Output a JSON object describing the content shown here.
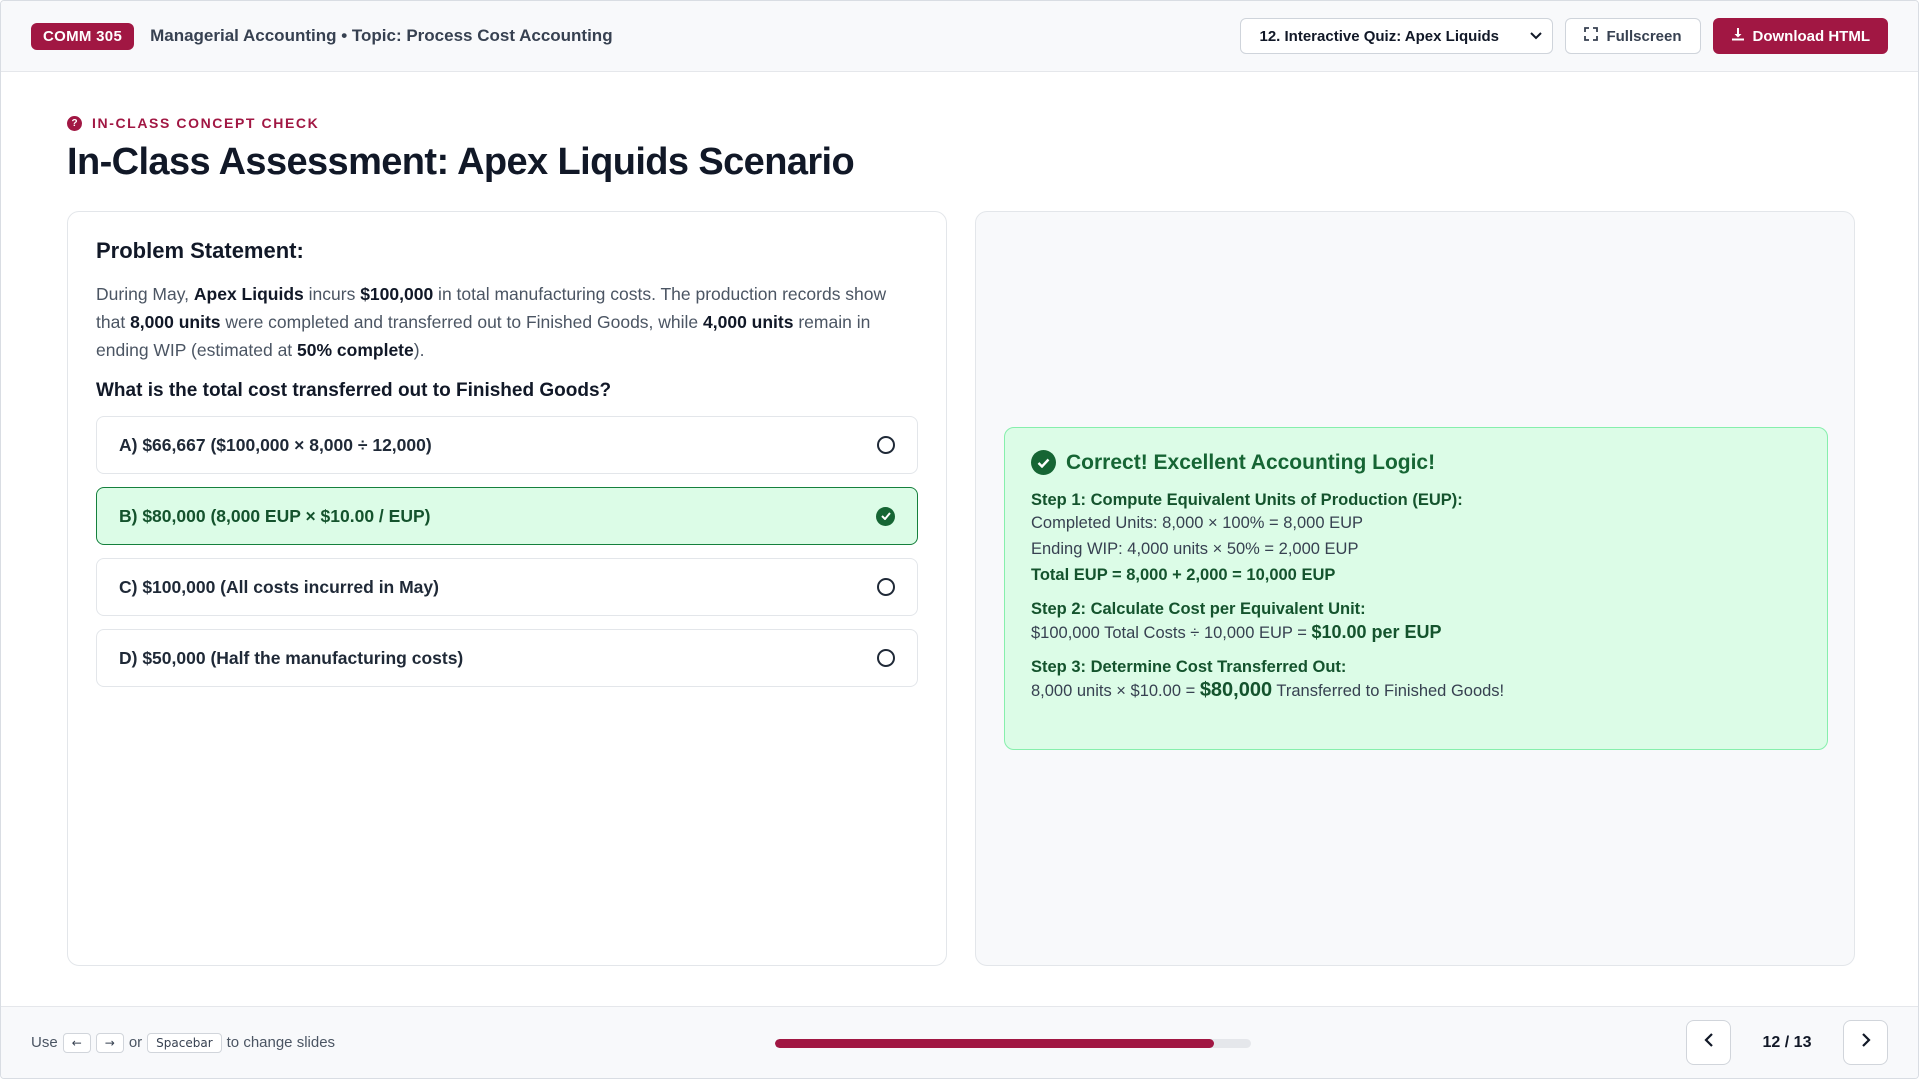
{
  "header": {
    "course_badge": "COMM 305",
    "title": "Managerial Accounting • Topic: Process Cost Accounting",
    "slide_select_value": "12. Interactive Quiz: Apex Liquids",
    "fullscreen_label": "Fullscreen",
    "download_label": "Download HTML"
  },
  "main": {
    "eyebrow": "IN-CLASS CONCEPT CHECK",
    "title": "In-Class Assessment: Apex Liquids Scenario",
    "problem": {
      "heading": "Problem Statement:",
      "t1": "During May, ",
      "b1": "Apex Liquids",
      "t2": " incurs ",
      "b2": "$100,000",
      "t3": " in total manufacturing costs. The production records show that ",
      "b3": "8,000 units",
      "t4": " were completed and transferred out to Finished Goods, while ",
      "b4": "4,000 units",
      "t5": " remain in ending WIP (estimated at ",
      "b5": "50% complete",
      "t6": ").",
      "question": "What is the total cost transferred out to Finished Goods?"
    },
    "options": [
      {
        "label": "A) $66,667 ($100,000 × 8,000 ÷ 12,000)"
      },
      {
        "label": "B) $80,000 (8,000 EUP × $10.00 / EUP)"
      },
      {
        "label": "C) $100,000 (All costs incurred in May)"
      },
      {
        "label": "D) $50,000 (Half the manufacturing costs)"
      }
    ],
    "feedback": {
      "title": "Correct! Excellent Accounting Logic!",
      "step1_title": "Step 1: Compute Equivalent Units of Production (EUP):",
      "step1_line1": "Completed Units: 8,000 × 100% = 8,000 EUP",
      "step1_line2": "Ending WIP: 4,000 units × 50% = 2,000 EUP",
      "step1_line3": "Total EUP = 8,000 + 2,000 = 10,000 EUP",
      "step2_title": "Step 2: Calculate Cost per Equivalent Unit:",
      "step2_pre": "$100,000 Total Costs ÷ 10,000 EUP = ",
      "step2_em": "$10.00 per EUP",
      "step3_title": "Step 3: Determine Cost Transferred Out:",
      "step3_pre": "8,000 units × $10.00 = ",
      "step3_em": "$80,000",
      "step3_post": " Transferred to Finished Goods!"
    }
  },
  "footer": {
    "use": "Use",
    "key_left": "←",
    "key_right": "→",
    "or": "or",
    "key_space": "Spacebar",
    "hint_tail": "to change slides",
    "progress_fraction": 0.923,
    "counter": "12 / 13"
  },
  "colors": {
    "brand": "#a11743",
    "success": "#166534",
    "success_bg": "#dcfce7"
  }
}
